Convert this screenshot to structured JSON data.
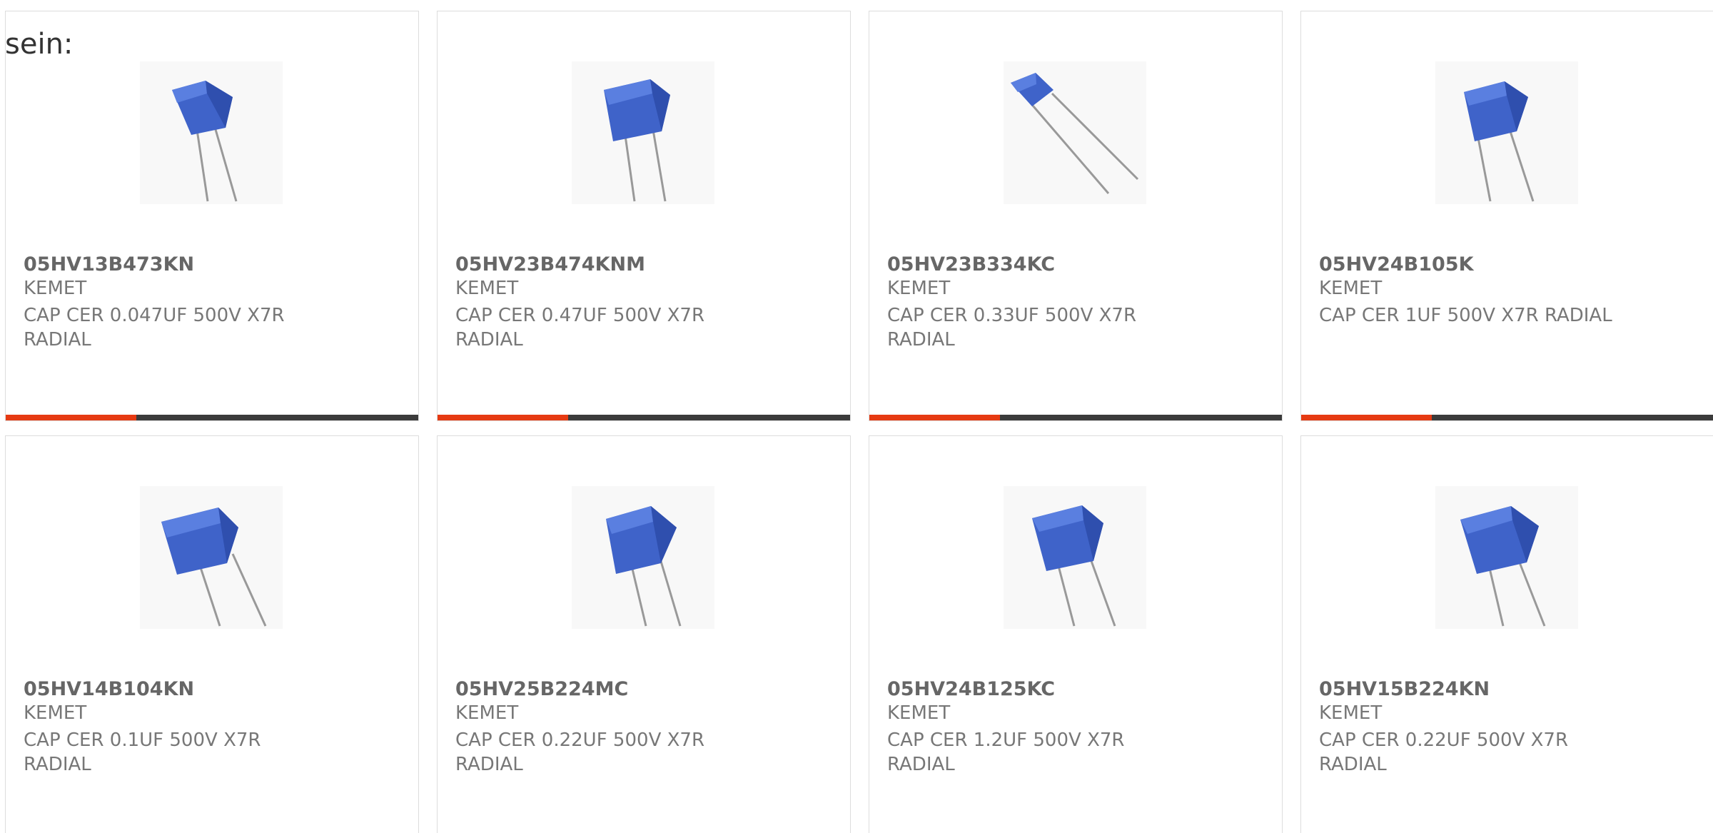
{
  "page": {
    "intro_text": "sein:"
  },
  "theme": {
    "accent": "#e63a12",
    "track": "#3b3b3b",
    "card_border": "#dddddd",
    "capacitor_blue": "#3f63c9"
  },
  "products": [
    {
      "part_number": "05HV13B473KN",
      "manufacturer": "KEMET",
      "description": "CAP CER 0.047UF 500V X7R RADIAL",
      "image_icon": "blue-radial-capacitor-icon",
      "progress_fraction": 0.316
    },
    {
      "part_number": "05HV23B474KNM",
      "manufacturer": "KEMET",
      "description": "CAP CER 0.47UF 500V X7R RADIAL",
      "image_icon": "blue-radial-capacitor-icon",
      "progress_fraction": 0.316
    },
    {
      "part_number": "05HV23B334KC",
      "manufacturer": "KEMET",
      "description": "CAP CER 0.33UF 500V X7R RADIAL",
      "image_icon": "blue-radial-capacitor-icon",
      "progress_fraction": 0.316
    },
    {
      "part_number": "05HV24B105K",
      "manufacturer": "KEMET",
      "description": "CAP CER 1UF 500V X7R RADIAL",
      "image_icon": "blue-radial-capacitor-icon",
      "progress_fraction": 0.316
    },
    {
      "part_number": "05HV14B104KN",
      "manufacturer": "KEMET",
      "description": "CAP CER 0.1UF 500V X7R RADIAL",
      "image_icon": "blue-radial-capacitor-icon"
    },
    {
      "part_number": "05HV25B224MC",
      "manufacturer": "KEMET",
      "description": "CAP CER 0.22UF 500V X7R RADIAL",
      "image_icon": "blue-radial-capacitor-icon"
    },
    {
      "part_number": "05HV24B125KC",
      "manufacturer": "KEMET",
      "description": "CAP CER 1.2UF 500V X7R RADIAL",
      "image_icon": "blue-radial-capacitor-icon"
    },
    {
      "part_number": "05HV15B224KN",
      "manufacturer": "KEMET",
      "description": "CAP CER 0.22UF 500V X7R RADIAL",
      "image_icon": "blue-radial-capacitor-icon"
    }
  ]
}
